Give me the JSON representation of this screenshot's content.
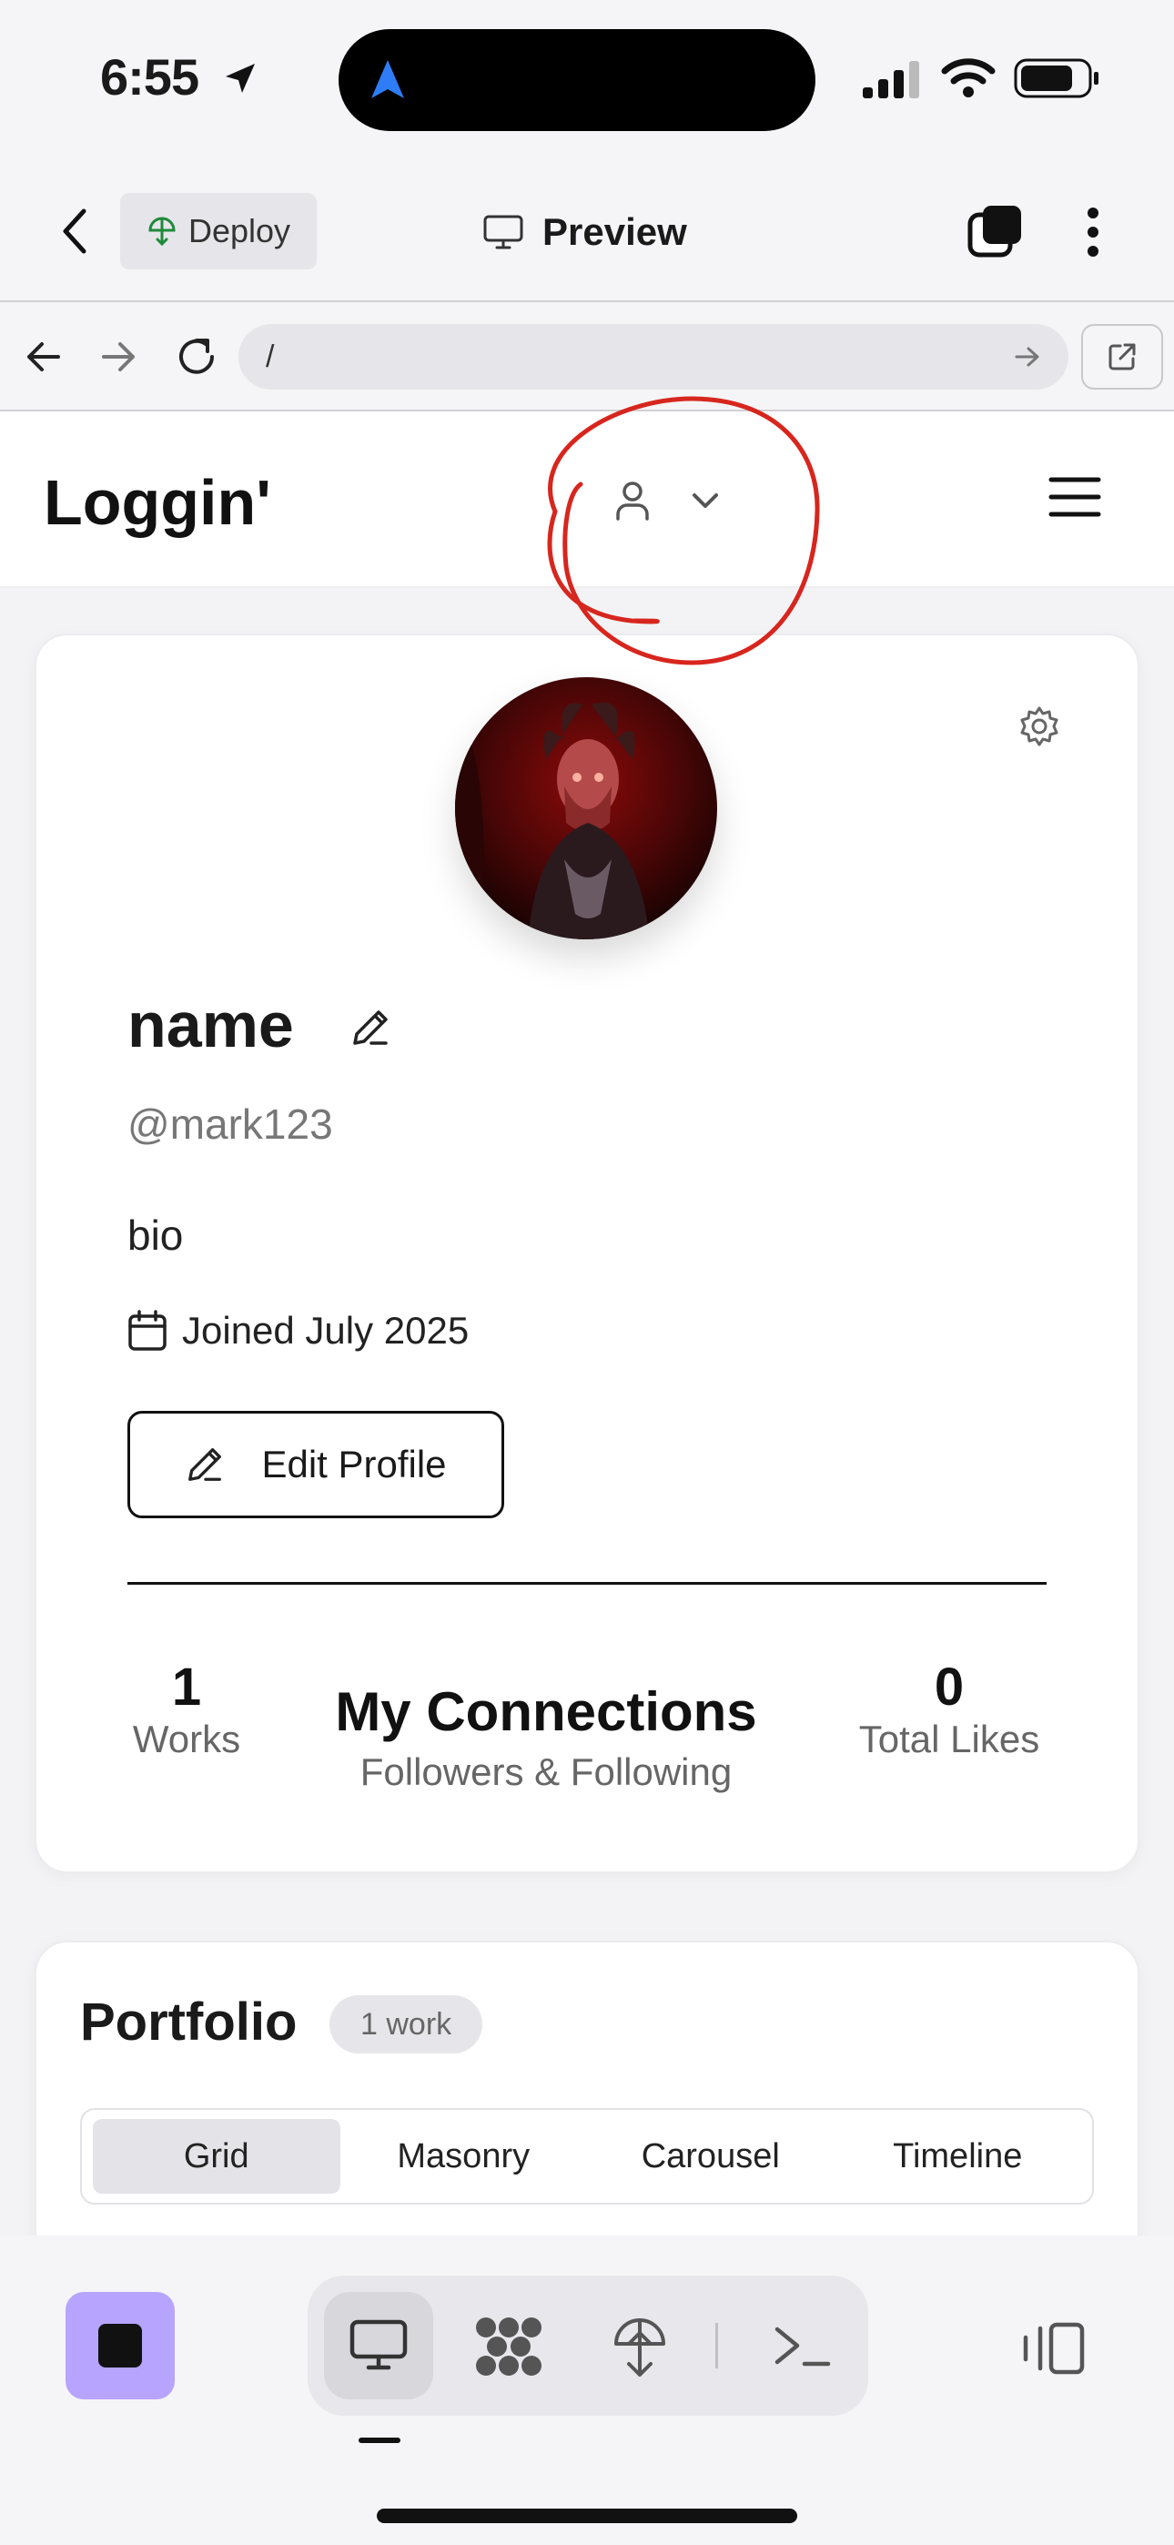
{
  "status_bar": {
    "time": "6:55"
  },
  "app_header": {
    "deploy_label": "Deploy",
    "preview_label": "Preview"
  },
  "browser": {
    "url": "/"
  },
  "site": {
    "logo": "Loggin'"
  },
  "profile": {
    "name": "name",
    "handle": "@mark123",
    "bio": "bio",
    "joined": "Joined July 2025",
    "edit_label": "Edit Profile",
    "stats": {
      "works_count": "1",
      "works_label": "Works",
      "connections_title": "My Connections",
      "connections_sub": "Followers & Following",
      "likes_count": "0",
      "likes_label": "Total Likes"
    }
  },
  "portfolio": {
    "title": "Portfolio",
    "badge": "1 work",
    "tabs": [
      "Grid",
      "Masonry",
      "Carousel",
      "Timeline"
    ],
    "active_tab": "Grid"
  },
  "colors": {
    "accent_purple": "#b7a4ff",
    "annotation_red": "#d7261e",
    "deploy_green": "#1f8a3a",
    "location_blue": "#2f7df6"
  },
  "icons": [
    "back-arrow-icon",
    "deploy-icon",
    "monitor-icon",
    "tabs-icon",
    "more-icon",
    "browser-back-icon",
    "browser-forward-icon",
    "reload-icon",
    "go-icon",
    "external-link-icon",
    "user-icon",
    "chevron-down-icon",
    "hamburger-menu-icon",
    "settings-gear-icon",
    "pencil-icon",
    "calendar-icon",
    "stop-icon",
    "desktop-icon",
    "workspace-icon",
    "deploy-tool-icon",
    "terminal-icon",
    "panel-toggle-icon"
  ]
}
